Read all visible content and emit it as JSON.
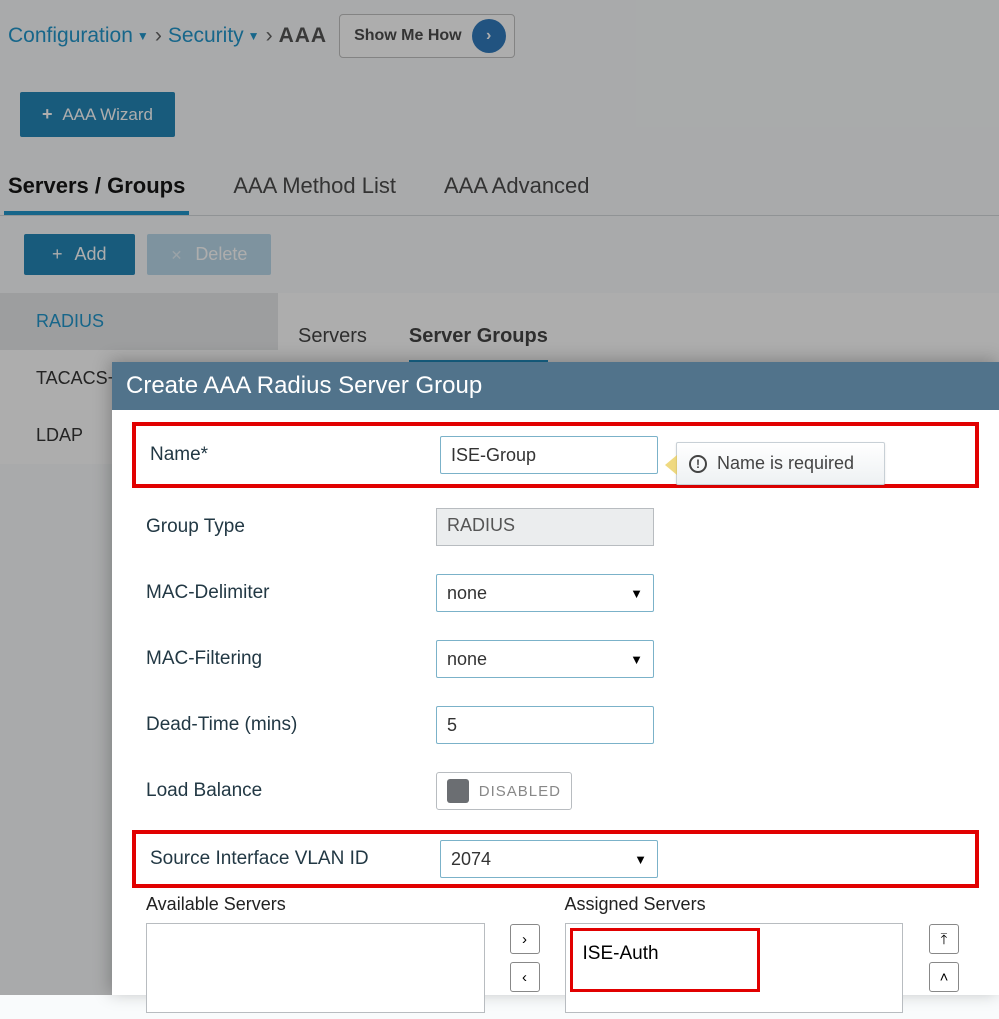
{
  "breadcrumb": {
    "configuration": "Configuration",
    "security": "Security",
    "current": "AAA",
    "show_me_how": "Show Me How"
  },
  "wizard": {
    "label": "AAA Wizard"
  },
  "main_tabs": [
    "Servers / Groups",
    "AAA Method List",
    "AAA Advanced"
  ],
  "actions": {
    "add": "Add",
    "delete": "Delete"
  },
  "sidebar": {
    "items": [
      "RADIUS",
      "TACACS+",
      "LDAP"
    ]
  },
  "subtabs": [
    "Servers",
    "Server Groups"
  ],
  "modal": {
    "title": "Create AAA Radius Server Group",
    "fields": {
      "name_label": "Name*",
      "name_value": "ISE-Group",
      "name_tip": "Name is required",
      "group_type_label": "Group Type",
      "group_type_value": "RADIUS",
      "mac_delim_label": "MAC-Delimiter",
      "mac_delim_value": "none",
      "mac_filter_label": "MAC-Filtering",
      "mac_filter_value": "none",
      "dead_time_label": "Dead-Time (mins)",
      "dead_time_value": "5",
      "load_balance_label": "Load Balance",
      "load_balance_value": "DISABLED",
      "src_vlan_label": "Source Interface VLAN ID",
      "src_vlan_value": "2074"
    },
    "dual_list": {
      "available_label": "Available Servers",
      "assigned_label": "Assigned Servers",
      "assigned_items": [
        "ISE-Auth"
      ]
    }
  }
}
